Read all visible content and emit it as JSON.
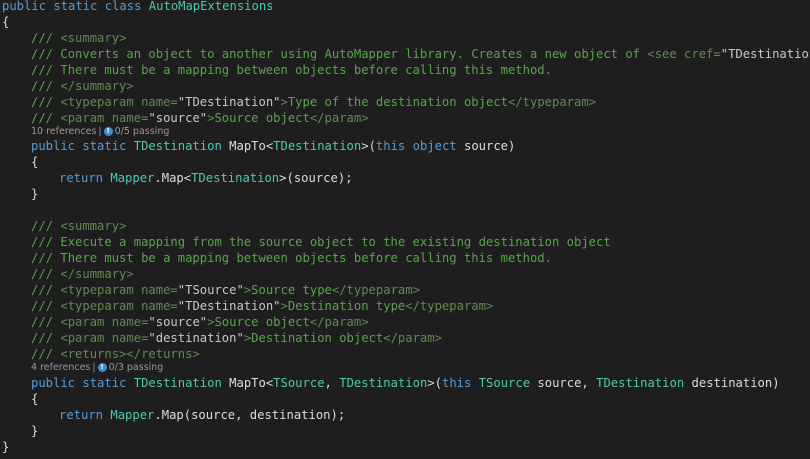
{
  "code": {
    "class_decl": {
      "kw": "public static class",
      "name": "AutoMapExtensions"
    },
    "brace_open": "{",
    "brace_close": "}",
    "method1": {
      "doc": {
        "prefix": "///",
        "summary_open": "<summary>",
        "summary_line1": "Converts an object to another using AutoMapper library. Creates a new object of ",
        "see_cref_open": "<see cref=",
        "see_cref_value": "\"TDestination\"",
        "see_cref_close": "/>.",
        "summary_line2": "There must be a mapping between objects before calling this method.",
        "summary_close": "</summary>",
        "typeparam_open": "<typeparam name=",
        "typeparam_name": "\"TDestination\"",
        "typeparam_gt": ">",
        "typeparam_text": "Type of the destination object",
        "typeparam_close": "</typeparam>",
        "param_open": "<param name=",
        "param_name": "\"source\"",
        "param_gt": ">",
        "param_text": "Source object",
        "param_close": "</param>"
      },
      "lens": {
        "references": "10 references",
        "tests": "0/5 passing"
      },
      "signature": {
        "modifiers": "public static",
        "return_type": "TDestination",
        "name": "MapTo<",
        "generic": "TDestination",
        "open": ">(",
        "this_kw": "this",
        "param_type": "object",
        "param_rest": "source)"
      },
      "body": {
        "return_kw": "return",
        "type": "Mapper",
        "call": ".Map<",
        "generic": "TDestination",
        "rest": ">(source);"
      }
    },
    "method2": {
      "doc": {
        "prefix": "///",
        "summary_open": "<summary>",
        "summary_line1": "Execute a mapping from the source object to the existing destination object",
        "summary_line2": "There must be a mapping between objects before calling this method.",
        "summary_close": "</summary>",
        "typeparam1_open": "<typeparam name=",
        "typeparam1_name": "\"TSource\"",
        "typeparam1_gt": ">",
        "typeparam1_text": "Source type",
        "typeparam1_close": "</typeparam>",
        "typeparam2_open": "<typeparam name=",
        "typeparam2_name": "\"TDestination\"",
        "typeparam2_gt": ">",
        "typeparam2_text": "Destination type",
        "typeparam2_close": "</typeparam>",
        "param1_open": "<param name=",
        "param1_name": "\"source\"",
        "param1_gt": ">",
        "param1_text": "Source object",
        "param1_close": "</param>",
        "param2_open": "<param name=",
        "param2_name": "\"destination\"",
        "param2_gt": ">",
        "param2_text": "Destination object",
        "param2_close": "</param>",
        "returns": "<returns></returns>"
      },
      "lens": {
        "references": "4 references",
        "tests": "0/3 passing"
      },
      "signature": {
        "modifiers": "public static",
        "return_type": "TDestination",
        "name": "MapTo<",
        "generic1": "TSource",
        "comma": ", ",
        "generic2": "TDestination",
        "open": ">(",
        "this_kw": "this",
        "p1_type": "TSource",
        "p1_rest": "source, ",
        "p2_type": "TDestination",
        "p2_rest": "destination)"
      },
      "body": {
        "return_kw": "return",
        "type": "Mapper",
        "rest": ".Map(source, destination);"
      }
    }
  },
  "icons": {
    "test_status": "test-flask-icon"
  },
  "colors": {
    "background": "#1e1e1e",
    "keyword": "#569cd6",
    "type": "#4ec9b0",
    "comment": "#57a64a",
    "text": "#dcdcdc",
    "codelens": "#999999",
    "test_icon": "#3c8fd6"
  }
}
